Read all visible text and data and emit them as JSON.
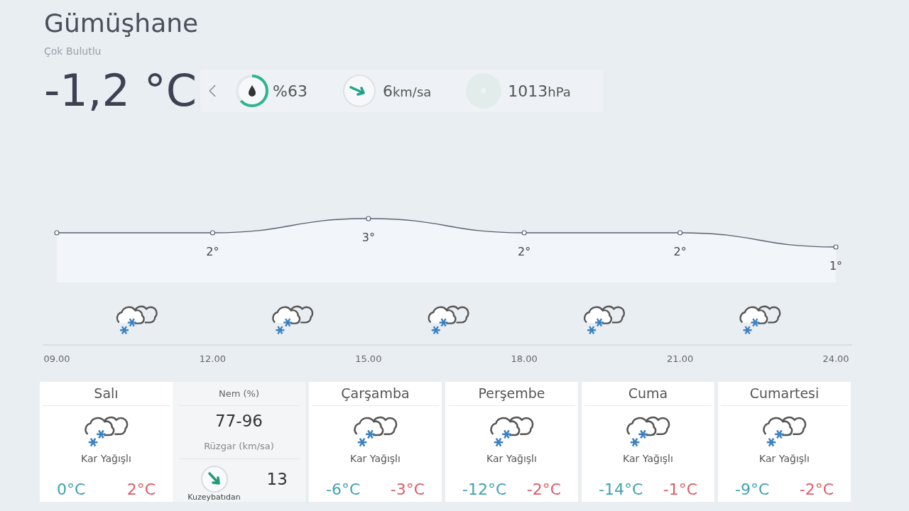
{
  "location": {
    "city": "Gümüşhane",
    "condition": "Çok Bulutlu",
    "temperature": "-1,2 °C"
  },
  "stats": {
    "humidity": {
      "value": "%63"
    },
    "wind": {
      "value": "6",
      "unit": "km/sa"
    },
    "pressure": {
      "value": "1013",
      "unit": "hPa"
    }
  },
  "hourly": {
    "chart_data": {
      "type": "area",
      "categories": [
        "09.00",
        "12.00",
        "15.00",
        "18.00",
        "21.00",
        "24.00"
      ],
      "series": [
        {
          "color": "#5a6170",
          "marker": true,
          "values": [
            2,
            2,
            3,
            2,
            2,
            1
          ],
          "value_labels": [
            null,
            "2°",
            "3°",
            "2°",
            "2°",
            "1°"
          ]
        }
      ]
    },
    "icons": [
      {
        "kind": "snow"
      },
      {
        "kind": "snow"
      },
      {
        "kind": "snow"
      },
      {
        "kind": "snow"
      },
      {
        "kind": "snow"
      }
    ]
  },
  "today": {
    "name": "Salı",
    "condition": "Kar Yağışlı",
    "kind": "snow",
    "min": "0°C",
    "max": "2°C"
  },
  "details": {
    "humidity_label": "Nem (%)",
    "humidity": "77-96",
    "wind_label": "Rüzgar (km/sa)",
    "wind_speed": "13",
    "wind_direction": "Kuzeybatıdan"
  },
  "days": [
    {
      "name": "Çarşamba",
      "condition": "Kar Yağışlı",
      "kind": "snow",
      "min": "-6°C",
      "max": "-3°C"
    },
    {
      "name": "Perşembe",
      "condition": "Kar Yağışlı",
      "kind": "snow",
      "min": "-12°C",
      "max": "-2°C"
    },
    {
      "name": "Cuma",
      "condition": "Kar Yağışlı",
      "kind": "snow",
      "min": "-14°C",
      "max": "-1°C"
    },
    {
      "name": "Cumartesi",
      "condition": "Kar Yağışlı",
      "kind": "snow",
      "min": "-9°C",
      "max": "-2°C"
    }
  ]
}
